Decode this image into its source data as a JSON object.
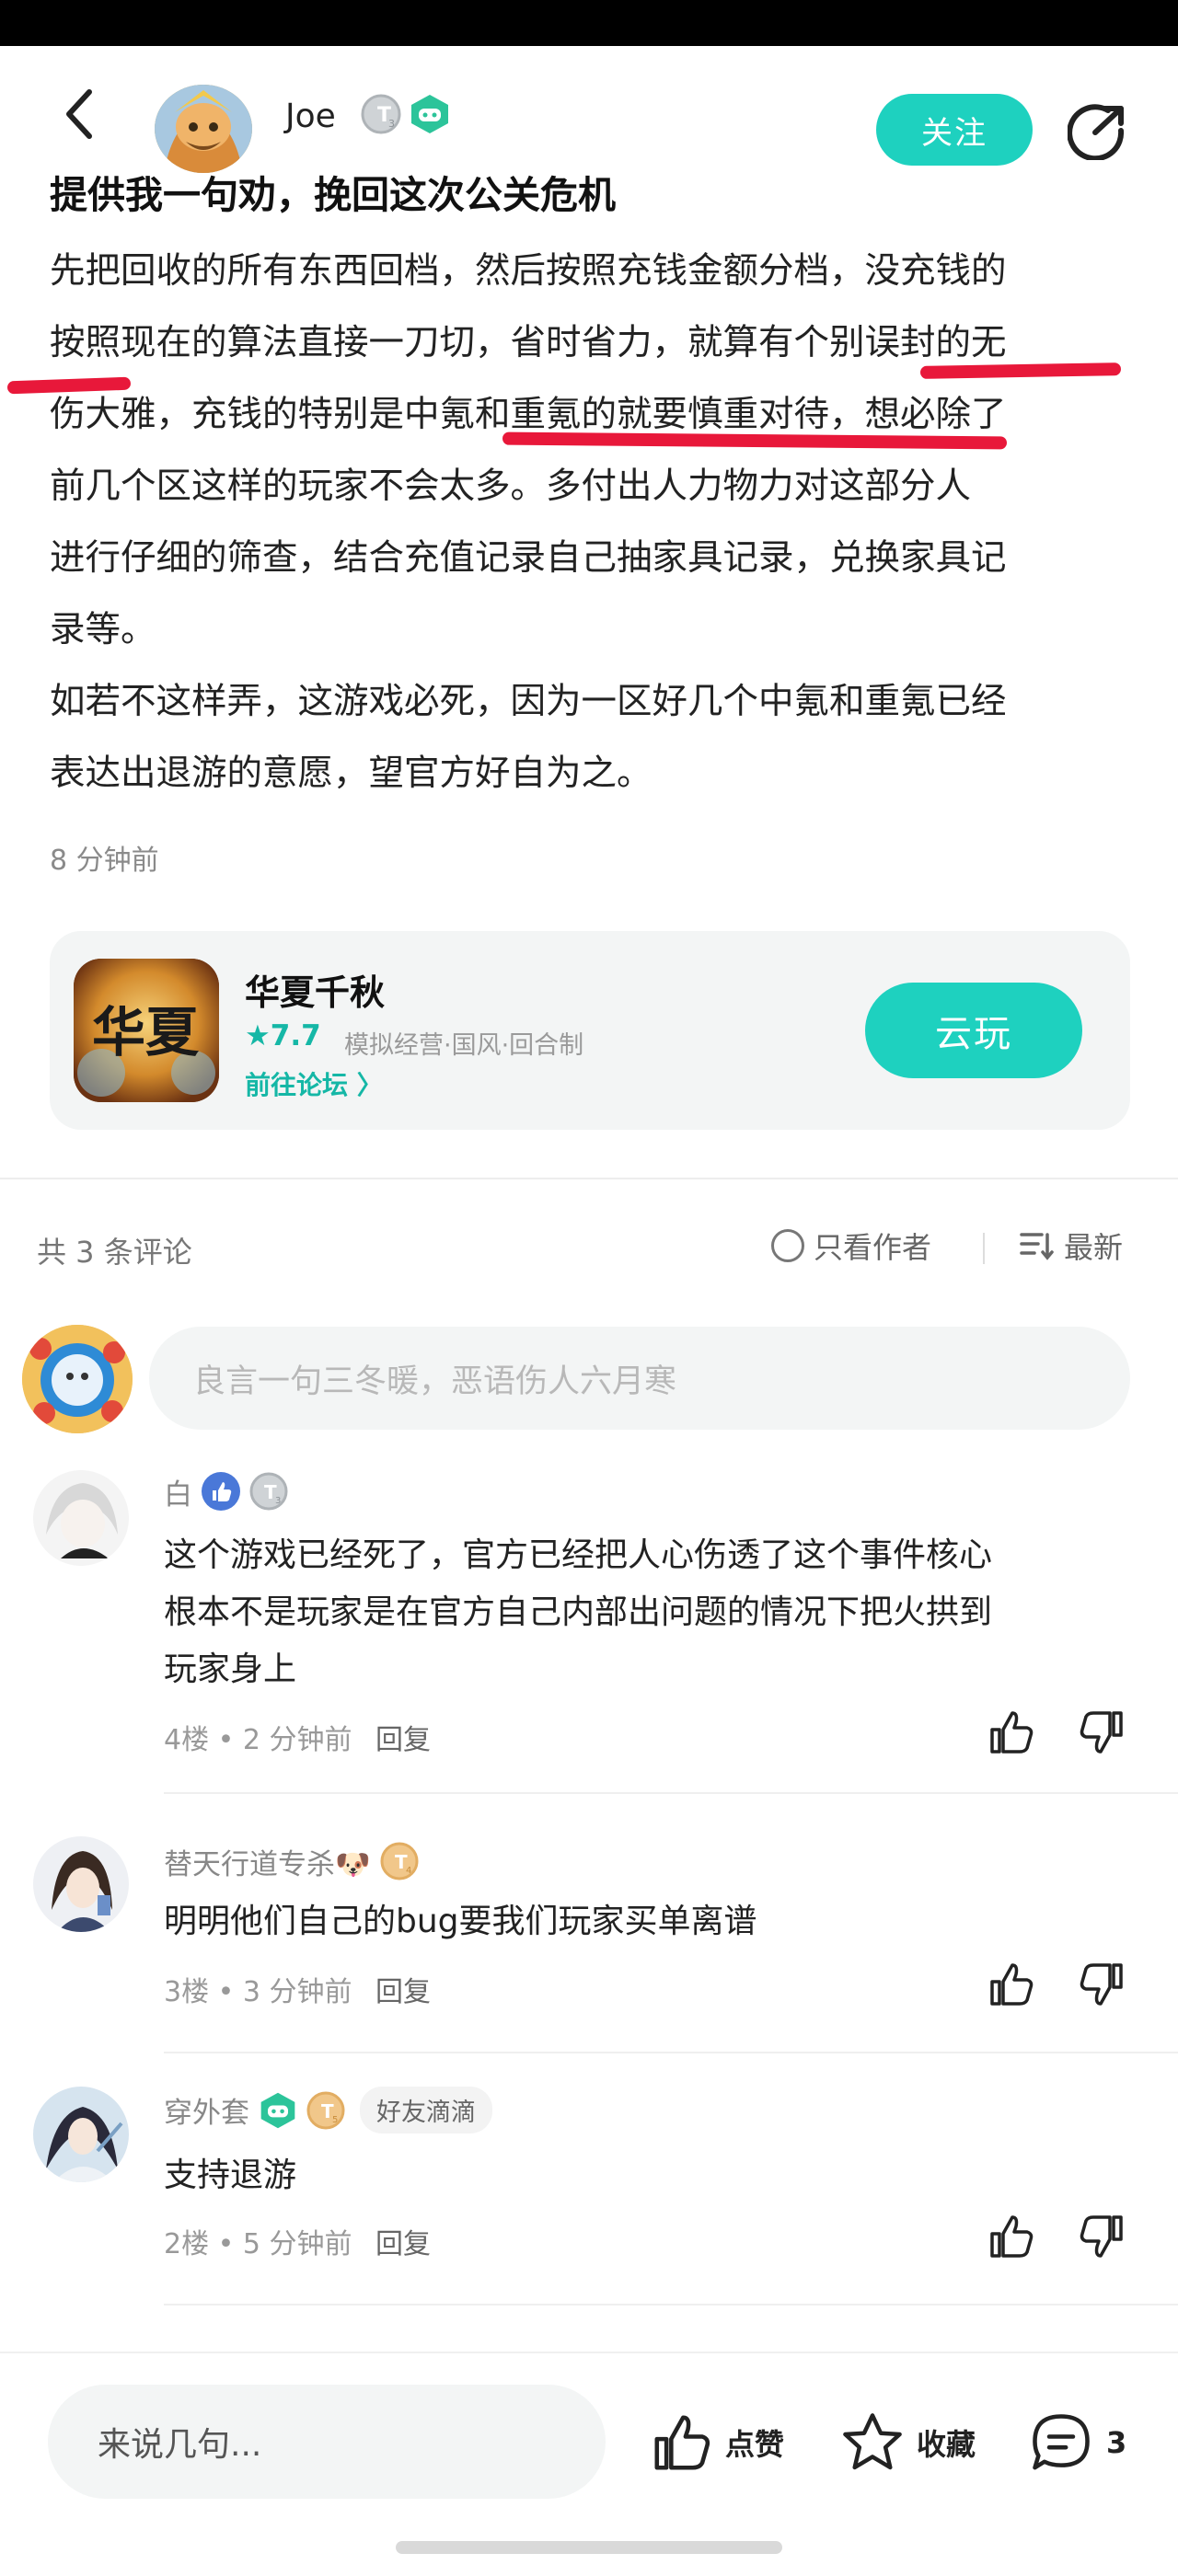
{
  "header": {
    "username": "Joe",
    "badge_level": "T3",
    "follow_label": "关注"
  },
  "post": {
    "title": "提供我一句劝，挽回这次公关危机",
    "lines": [
      "先把回收的所有东西回档，然后按照充钱金额分档，没充钱的",
      "按照现在的算法直接一刀切，省时省力，就算有个别误封的无",
      "伤大雅，充钱的特别是中氪和重氪的就要慎重对待，想必除了",
      "前几个区这样的玩家不会太多。多付出人力物力对这部分人",
      "进行仔细的筛查，结合充值记录自己抽家具记录，兑换家具记",
      "录等。",
      "如若不这样弄，这游戏必死，因为一区好几个中氪和重氪已经",
      "表达出退游的意愿，望官方好自为之。"
    ],
    "time": "8 分钟前"
  },
  "game": {
    "icon_text": "华夏",
    "name": "华夏千秋",
    "rating": "★7.7",
    "tags": "模拟经营·国风·回合制",
    "forum_link": "前往论坛 〉",
    "cloud_play": "云玩"
  },
  "comments_header": {
    "count_label": "共 3 条评论",
    "author_only": "只看作者",
    "sort": "最新"
  },
  "comment_input": {
    "placeholder": "良言一句三冬暖，恶语伤人六月寒"
  },
  "comments": [
    {
      "name": "白",
      "badge": "T3",
      "text_lines": [
        "这个游戏已经死了，官方已经把人心伤透了这个事件核心",
        "根本不是玩家是在官方自己内部出问题的情况下把火拱到",
        "玩家身上"
      ],
      "meta": "4楼 • 2 分钟前",
      "reply": "回复"
    },
    {
      "name": "替天行道专杀🐶",
      "badge": "T4",
      "text_lines": [
        "明明他们自己的bug要我们玩家买单离谱"
      ],
      "meta": "3楼 • 3 分钟前",
      "reply": "回复"
    },
    {
      "name": "穿外套",
      "badge": "T5",
      "tag": "好友滴滴",
      "text_lines": [
        "支持退游"
      ],
      "meta": "2楼 • 5 分钟前",
      "reply": "回复"
    }
  ],
  "bottom_bar": {
    "say_placeholder": "来说几句...",
    "like_label": "点赞",
    "collect_label": "收藏",
    "comment_count": "3"
  },
  "colors": {
    "accent": "#1ed1bf",
    "accent_text": "#15b7a6",
    "highlight_red": "#e8183a"
  }
}
